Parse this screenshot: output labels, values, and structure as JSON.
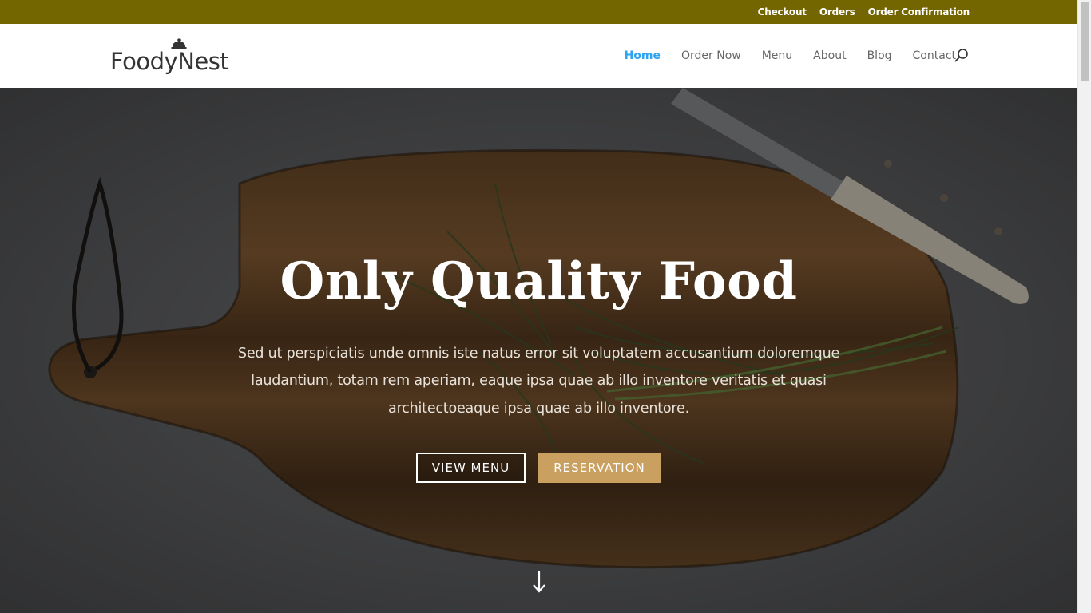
{
  "topbar": {
    "links": [
      "Checkout",
      "Orders",
      "Order Confirmation"
    ]
  },
  "header": {
    "logo_text": "FoodyNest",
    "nav": [
      "Home",
      "Order Now",
      "Menu",
      "About",
      "Blog",
      "Contact"
    ],
    "active_nav": "Home",
    "search_icon": "search-icon"
  },
  "hero": {
    "title": "Only Quality Food",
    "text": "Sed ut perspiciatis unde omnis iste natus error sit voluptatem accusantium doloremque laudantium, totam rem aperiam, eaque ipsa quae ab illo inventore veritatis et quasi architectoeaque ipsa quae ab illo inventore.",
    "buttons": {
      "view_menu": "VIEW MENU",
      "reservation": "RESERVATION"
    },
    "scroll_icon": "arrow-down-icon"
  },
  "colors": {
    "topbar": "#736500",
    "accent_nav": "#2ea3f2",
    "reservation_button": "#c9a060"
  }
}
